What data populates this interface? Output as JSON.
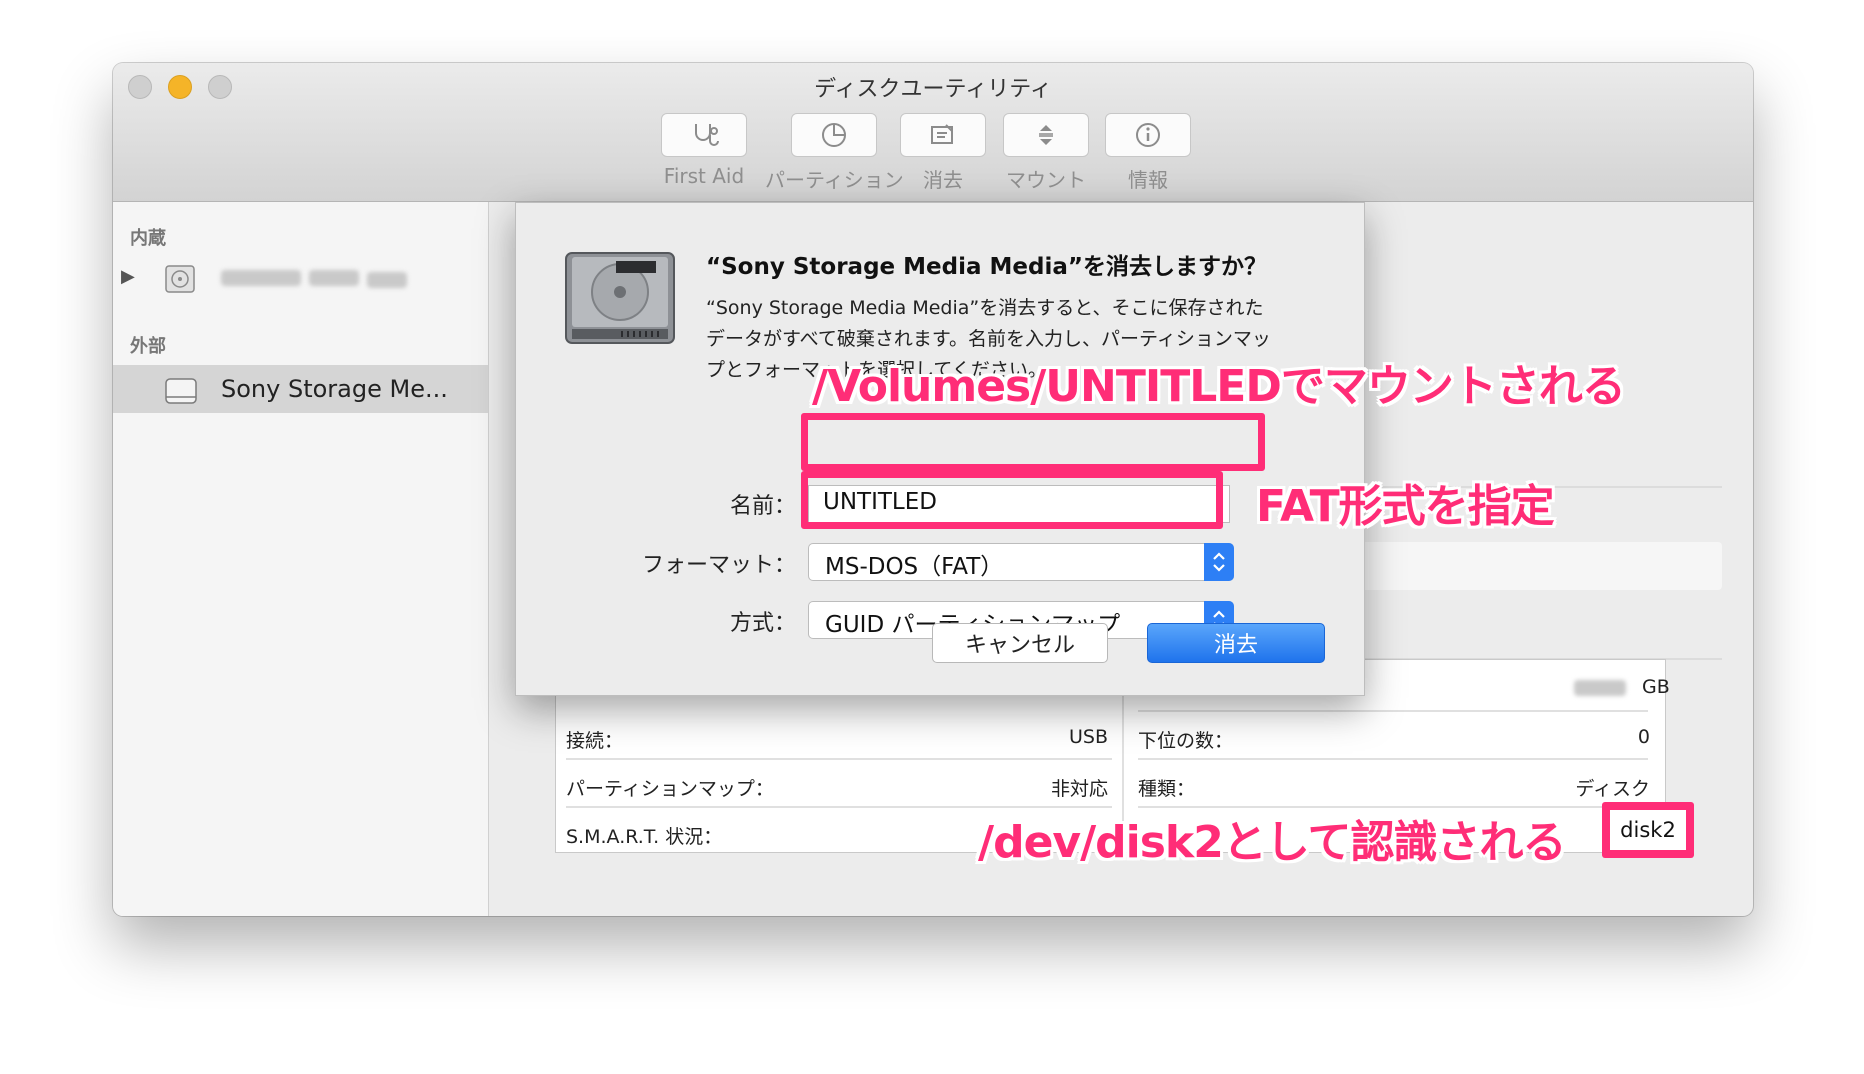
{
  "window": {
    "title": "ディスクユーティリティ"
  },
  "toolbar": {
    "first_aid": "First Aid",
    "partition": "パーティション",
    "erase": "消去",
    "mount": "マウント",
    "info": "情報"
  },
  "sidebar": {
    "internal_heading": "内蔵",
    "external_heading": "外部",
    "external_device": "Sony Storage Me..."
  },
  "dialog": {
    "title": "“Sony Storage Media Media”を消去しますか？",
    "body_line1": "“Sony Storage Media Media”を消去すると、そこに保存された",
    "body_line2": "データがすべて破棄されます。名前を入力し、パーティションマッ",
    "body_line3": "プとフォーマットを選択してください。",
    "name_label": "名前：",
    "name_value": "UNTITLED",
    "format_label": "フォーマット：",
    "format_value": "MS-DOS（FAT）",
    "scheme_label": "方式：",
    "scheme_value": "GUID パーティションマップ",
    "cancel_label": "キャンセル",
    "erase_label": "消去"
  },
  "info": {
    "capacity_unit": "GB",
    "connection_label": "接続：",
    "connection_value": "USB",
    "children_label": "下位の数：",
    "children_value": "0",
    "partition_map_label": "パーティションマップ：",
    "partition_map_value": "非対応",
    "type_label": "種類：",
    "type_value": "ディスク",
    "smart_label": "S.M.A.R.T. 状況：",
    "device_value": "disk2"
  },
  "annotations": {
    "mount": "/Volumes/UNTITLEDでマウントされる",
    "format": "FAT形式を指定",
    "device": "/dev/disk2として認識される"
  },
  "colors": {
    "highlight": "#ff2d77",
    "accent": "#2d7ff5"
  }
}
